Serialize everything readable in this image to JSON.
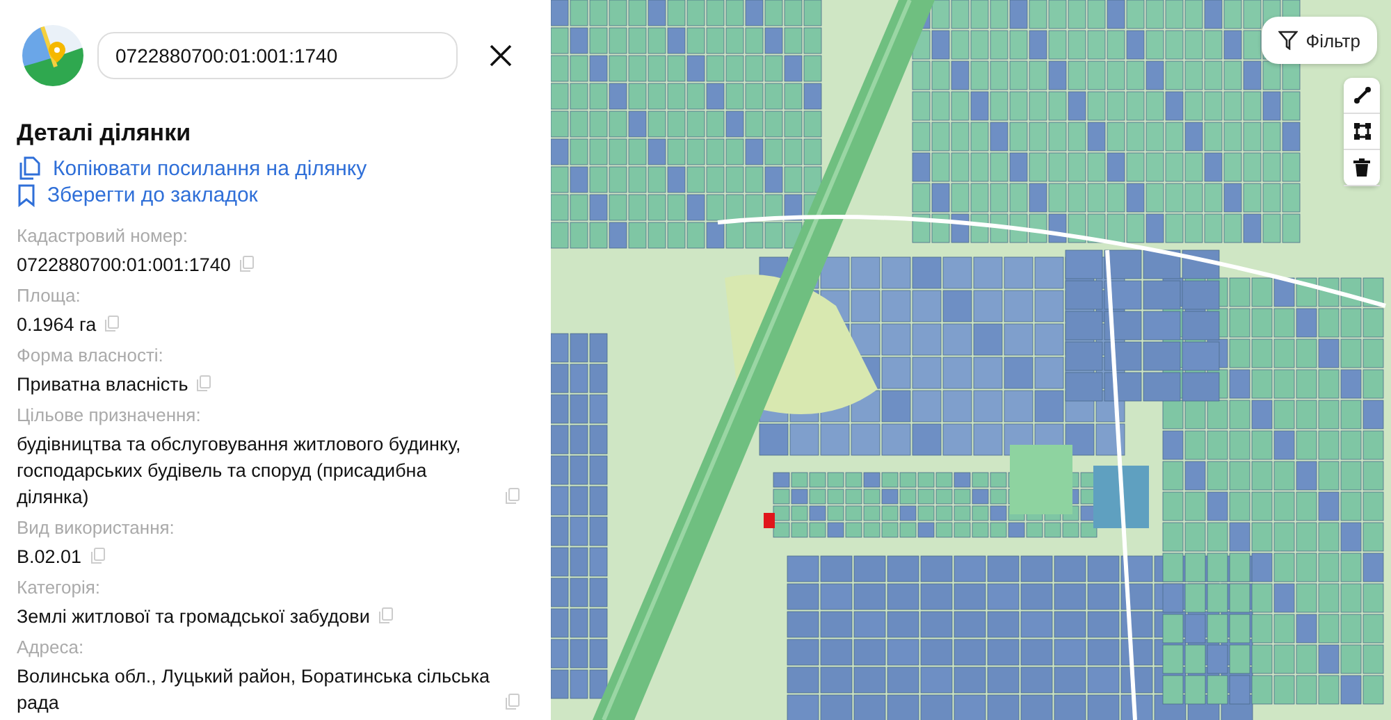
{
  "search": {
    "value": "0722880700:01:001:1740"
  },
  "details": {
    "title": "Деталі ділянки",
    "actions": [
      {
        "kind": "copy",
        "label": "Копіювати посилання на ділянку"
      },
      {
        "kind": "bookmark",
        "label": "Зберегти до закладок"
      }
    ],
    "fields": [
      {
        "label": "Кадастровий номер:",
        "value": "0722880700:01:001:1740"
      },
      {
        "label": "Площа:",
        "value": "0.1964 га"
      },
      {
        "label": "Форма власності:",
        "value": "Приватна власність"
      },
      {
        "label": "Цільове призначення:",
        "value": "будівництва та обслуговування житлового будинку, господарських будівель та споруд (присадибна ділянка)"
      },
      {
        "label": "Вид використання:",
        "value": "В.02.01"
      },
      {
        "label": "Категорія:",
        "value": "Землі житлової та громадської забудови"
      },
      {
        "label": "Адреса:",
        "value": "Волинська обл., Луцький район, Боратинська сільська рада"
      }
    ]
  },
  "map": {
    "filter_button": "Фільтр",
    "tools": [
      {
        "kind": "line"
      },
      {
        "kind": "polygon"
      },
      {
        "kind": "delete"
      }
    ]
  }
}
